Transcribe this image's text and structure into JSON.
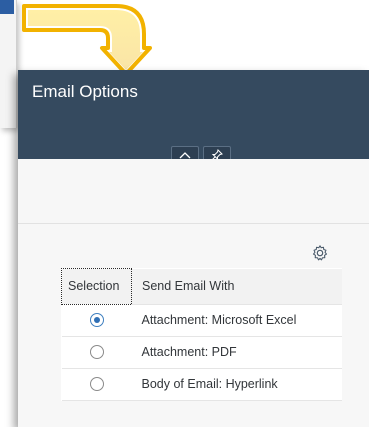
{
  "dialog": {
    "title": "Email Options",
    "collapse_icon": "chevron-up-icon",
    "pin_icon": "pin-icon"
  },
  "table": {
    "settings_icon": "gear-icon",
    "headers": {
      "selection": "Selection",
      "send_with": "Send Email With"
    },
    "rows": [
      {
        "label": "Attachment: Microsoft Excel",
        "selected": true
      },
      {
        "label": "Attachment: PDF",
        "selected": false
      },
      {
        "label": "Body of Email: Hyperlink",
        "selected": false
      }
    ]
  },
  "colors": {
    "header_bg": "#354a5f",
    "arrow": "#f5c400",
    "radio_selected": "#2f6fb5"
  }
}
